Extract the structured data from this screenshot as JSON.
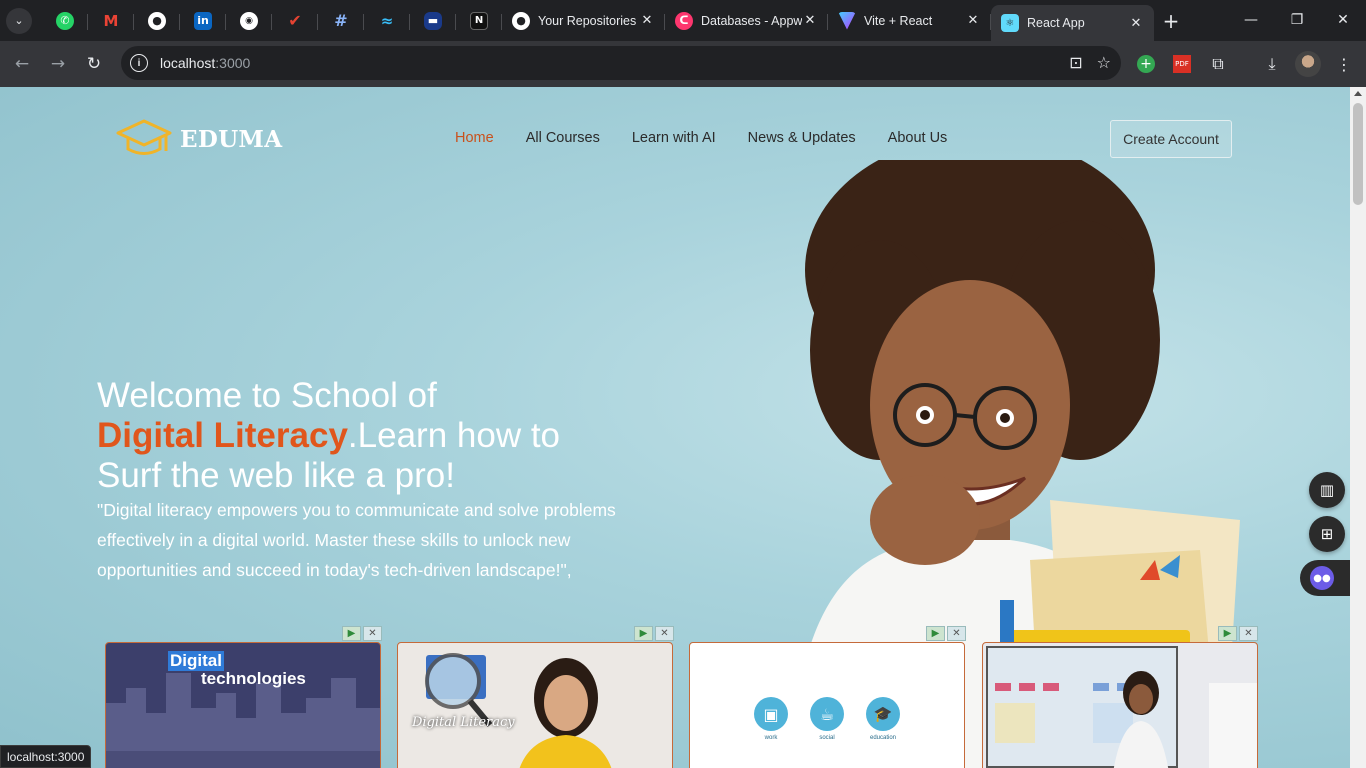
{
  "browser": {
    "tabs": [
      {
        "title": "Your Repositories",
        "active": false
      },
      {
        "title": "Databases - Appwrite",
        "active": false
      },
      {
        "title": "Vite + React",
        "active": false
      },
      {
        "title": "React App",
        "active": true
      }
    ],
    "pinned_tabs": [
      "whatsapp-icon",
      "gmail-icon",
      "github-icon",
      "linkedin-icon",
      "chatbot-icon",
      "tick-icon",
      "hashnode-icon",
      "tailwind-icon",
      "pill-icon",
      "notion-icon"
    ],
    "url_host": "localhost",
    "url_port": ":3000",
    "status_text": "localhost:3000"
  },
  "site": {
    "logo_text": "EDUMA",
    "nav": [
      {
        "label": "Home",
        "active": true
      },
      {
        "label": "All Courses",
        "active": false
      },
      {
        "label": "Learn with AI",
        "active": false
      },
      {
        "label": "News & Updates",
        "active": false
      },
      {
        "label": "About Us",
        "active": false
      }
    ],
    "create_account": "Create Account",
    "hero": {
      "line1": "Welcome to School of",
      "highlight": "Digital Literacy",
      "line2_rest": ".Learn how to",
      "line3": "Surf the web like a pro!",
      "quote": "\"Digital literacy empowers you to communicate and solve problems effectively in a digital world. Master these skills to unlock new opportunities and succeed in today's tech-driven landscape!\","
    },
    "cards": [
      {
        "title_a": "Digital",
        "title_b": "technologies"
      },
      {
        "caption": "Digital Literacy"
      },
      {
        "labels": [
          "work",
          "social",
          "education"
        ]
      },
      {
        "kind": "classroom"
      }
    ]
  },
  "colors": {
    "accent": "#e0561c",
    "nav_active": "#c9511c",
    "logo_cap": "#f0b429"
  }
}
